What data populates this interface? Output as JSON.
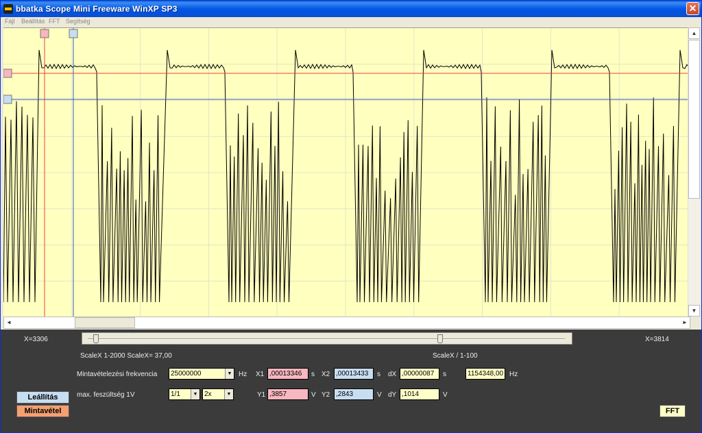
{
  "window": {
    "title": "bbatka Scope Mini Freeware WinXP SP3",
    "close_glyph": "✕"
  },
  "menu": {
    "items": [
      "Fájl",
      "Beállítás",
      "FFT",
      "Segítség"
    ]
  },
  "scope": {
    "background": "#ffffbf",
    "trace_color": "#000000",
    "cursor1_color": "#e84040",
    "cursor2_color": "#3060c8",
    "grid_color": "#e4e4c8"
  },
  "range": {
    "x_start": "X=3306",
    "x_end": "X=3814",
    "scale_left": "ScaleX 1-2000   ScaleX= 37,00",
    "scale_right": "ScaleX / 1-100"
  },
  "controls": {
    "sample_label": "Mintavételezési frekvencia",
    "sample_value": "25000000",
    "sample_unit": "Hz",
    "voltage_label": "max. feszültség 1V",
    "ratio_value": "1/1",
    "gain_value": "2x",
    "x1_label": "X1",
    "x1_value": ",00013346",
    "x1_unit": "s",
    "x2_label": "X2",
    "x2_value": ",00013433",
    "x2_unit": "s",
    "dx_label": "dX",
    "dx_value": ",00000087",
    "dx_unit": "s",
    "freq_value": "1154348,00",
    "freq_unit": "Hz",
    "y1_label": "Y1",
    "y1_value": ",3857",
    "y1_unit": "V",
    "y2_label": "Y2",
    "y2_value": ",2843",
    "y2_unit": "V",
    "dy_label": "dY",
    "dy_value": ",1014",
    "dy_unit": "V"
  },
  "buttons": {
    "stop": "Leállítás",
    "sample": "Mintavétel",
    "fft": "FFT"
  }
}
